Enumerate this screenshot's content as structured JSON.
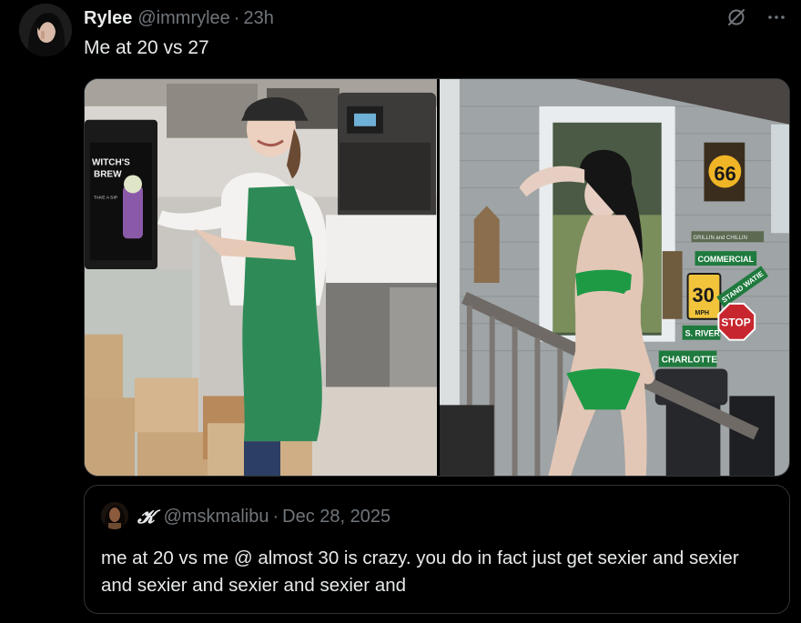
{
  "tweet": {
    "author": {
      "display_name": "Rylee",
      "handle": "@immrylee",
      "avatar_icon": "avatar-icon"
    },
    "separator": "·",
    "time": "23h",
    "text": "Me at 20 vs 27",
    "header_icons": [
      "grok-icon",
      "more-icon"
    ],
    "media": {
      "left": {
        "sign_lines": [
          "WITCH'S",
          "BREW"
        ],
        "sign_small": "TAKE A SIP"
      },
      "right": {
        "sign_66": "66",
        "sign_grillin": "GRILLIN and CHILLIN",
        "sign_commercial": "COMMERCIAL",
        "sign_30": "30",
        "sign_30_unit": "MPH",
        "sign_stand": "STAND WATIE",
        "sign_river": "S. RIVER",
        "sign_stop": "STOP",
        "sign_charlotte": "CHARLOTTE"
      }
    }
  },
  "quote": {
    "author": {
      "display_name": "𝓚",
      "handle": "@mskmalibu"
    },
    "separator": "·",
    "date": "Dec 28, 2025",
    "text": "me at 20 vs me @ almost 30 is crazy. you do in fact just get sexier and sexier and sexier and sexier and sexier and"
  },
  "colors": {
    "background": "#000000",
    "text_primary": "#e7e9ea",
    "text_secondary": "#71767b",
    "border": "#2f3336"
  }
}
